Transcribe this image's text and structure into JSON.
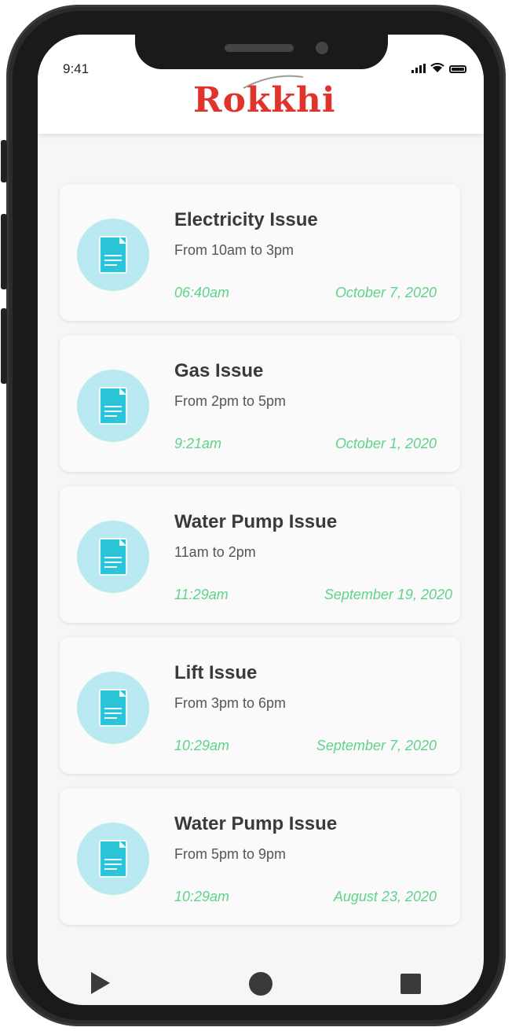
{
  "status_bar": {
    "time": "9:41"
  },
  "header": {
    "logo_text": "Rokkhi",
    "brand_color": "#e0332b"
  },
  "accent_color": "#5ed38a",
  "icon_bg_color": "#b9e8f0",
  "issues": [
    {
      "title": "Electricity Issue",
      "subtitle": "From 10am to 3pm",
      "time": "06:40am",
      "date": "October 7, 2020",
      "icon": "document-icon"
    },
    {
      "title": "Gas Issue",
      "subtitle": "From 2pm to 5pm",
      "time": "9:21am",
      "date": "October 1, 2020",
      "icon": "document-icon"
    },
    {
      "title": "Water Pump Issue",
      "subtitle": "11am to 2pm",
      "time": "11:29am",
      "date": "September 19, 2020",
      "icon": "document-icon"
    },
    {
      "title": "Lift Issue",
      "subtitle": "From 3pm to 6pm",
      "time": "10:29am",
      "date": "September 7, 2020",
      "icon": "document-icon"
    },
    {
      "title": "Water Pump Issue",
      "subtitle": "From 5pm to 9pm",
      "time": "10:29am",
      "date": "August 23, 2020",
      "icon": "document-icon"
    }
  ],
  "nav_bar": {
    "buttons": [
      "back-icon",
      "home-icon",
      "recent-apps-icon"
    ]
  }
}
